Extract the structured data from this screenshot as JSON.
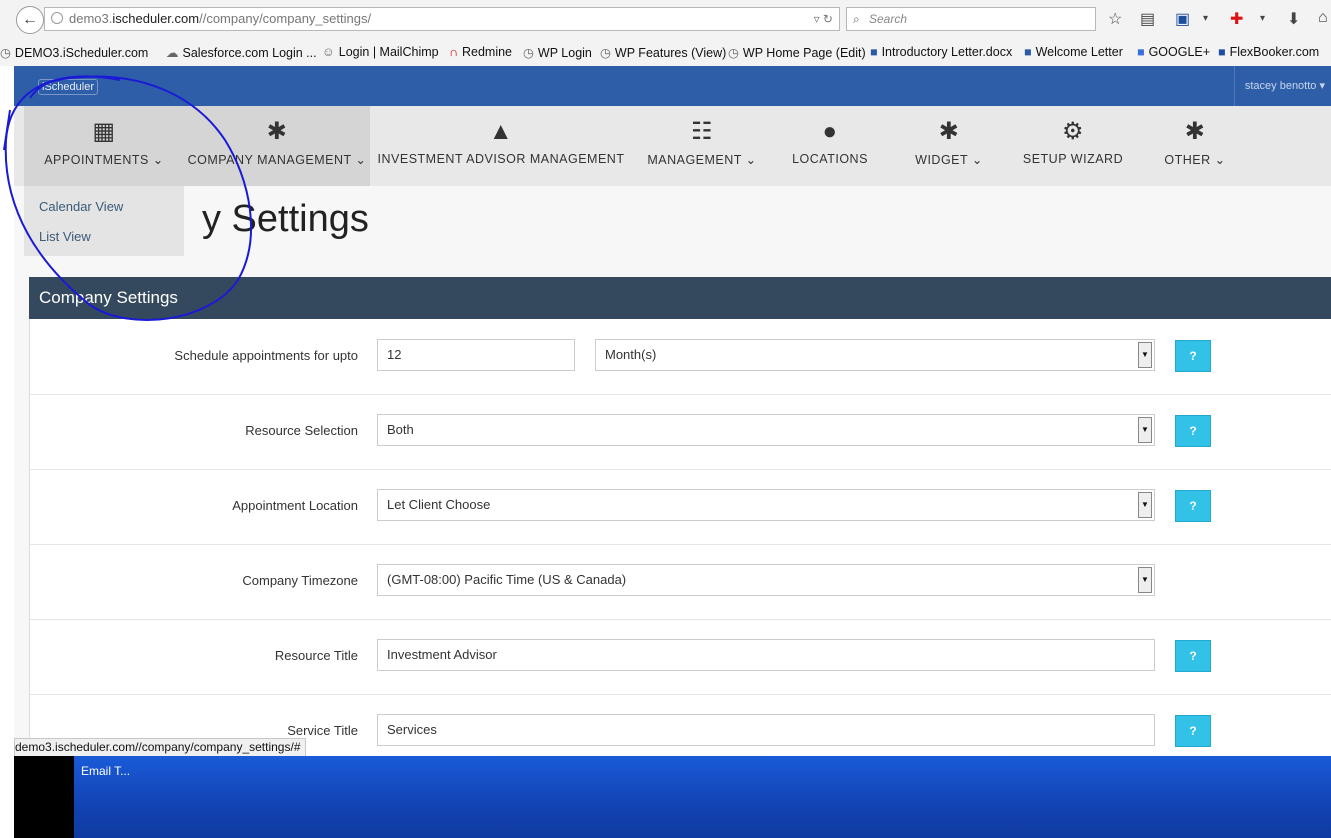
{
  "browser": {
    "url_domain_prefix": "demo3.",
    "url_domain": "ischeduler.com",
    "url_path": "//company/company_settings/",
    "search_placeholder": "Search",
    "bookmarks": [
      "DEMO3.iScheduler.com",
      "Salesforce.com Login ...",
      "Login | MailChimp",
      "Redmine",
      "WP Login",
      "WP Features (View)",
      "WP Home Page (Edit)",
      "Introductory Letter.docx",
      "Welcome Letter",
      "GOOGLE+",
      "FlexBooker.com"
    ]
  },
  "app": {
    "logo": "iScheduler",
    "user": "stacey benotto ▾",
    "nav": [
      {
        "label": "APPOINTMENTS ⌄",
        "icon": "calendar-icon"
      },
      {
        "label": "COMPANY MANAGEMENT ⌄",
        "icon": "asterisk-icon"
      },
      {
        "label": "INVESTMENT ADVISOR MANAGEMENT",
        "icon": "user-icon"
      },
      {
        "label": "MANAGEMENT ⌄",
        "icon": "list-icon"
      },
      {
        "label": "LOCATIONS",
        "icon": "globe-icon"
      },
      {
        "label": "WIDGET ⌄",
        "icon": "asterisk-icon"
      },
      {
        "label": "SETUP WIZARD",
        "icon": "gears-icon"
      },
      {
        "label": "OTHER ⌄",
        "icon": "asterisk-icon"
      }
    ],
    "dropdown": [
      "Calendar View",
      "List View"
    ],
    "page_title": "y Settings",
    "section_title": "Company Settings",
    "form": {
      "schedule": {
        "label": "Schedule appointments for upto",
        "value": "12",
        "unit": "Month(s)"
      },
      "resource_selection": {
        "label": "Resource Selection",
        "value": "Both"
      },
      "appointment_location": {
        "label": "Appointment Location",
        "value": "Let Client Choose"
      },
      "timezone": {
        "label": "Company Timezone",
        "value": "(GMT-08:00) Pacific Time (US & Canada)"
      },
      "resource_title": {
        "label": "Resource Title",
        "value": "Investment Advisor"
      },
      "service_title": {
        "label": "Service Title",
        "value": "Services"
      },
      "help_label": "?"
    }
  },
  "status_bar": "demo3.ischeduler.com//company/company_settings/#",
  "taskbar": {
    "item": "Email T..."
  },
  "colors": {
    "topbar": "#2e5ea8",
    "section": "#34495e",
    "help": "#32c2e8",
    "annotation": "#1a1ad6"
  }
}
